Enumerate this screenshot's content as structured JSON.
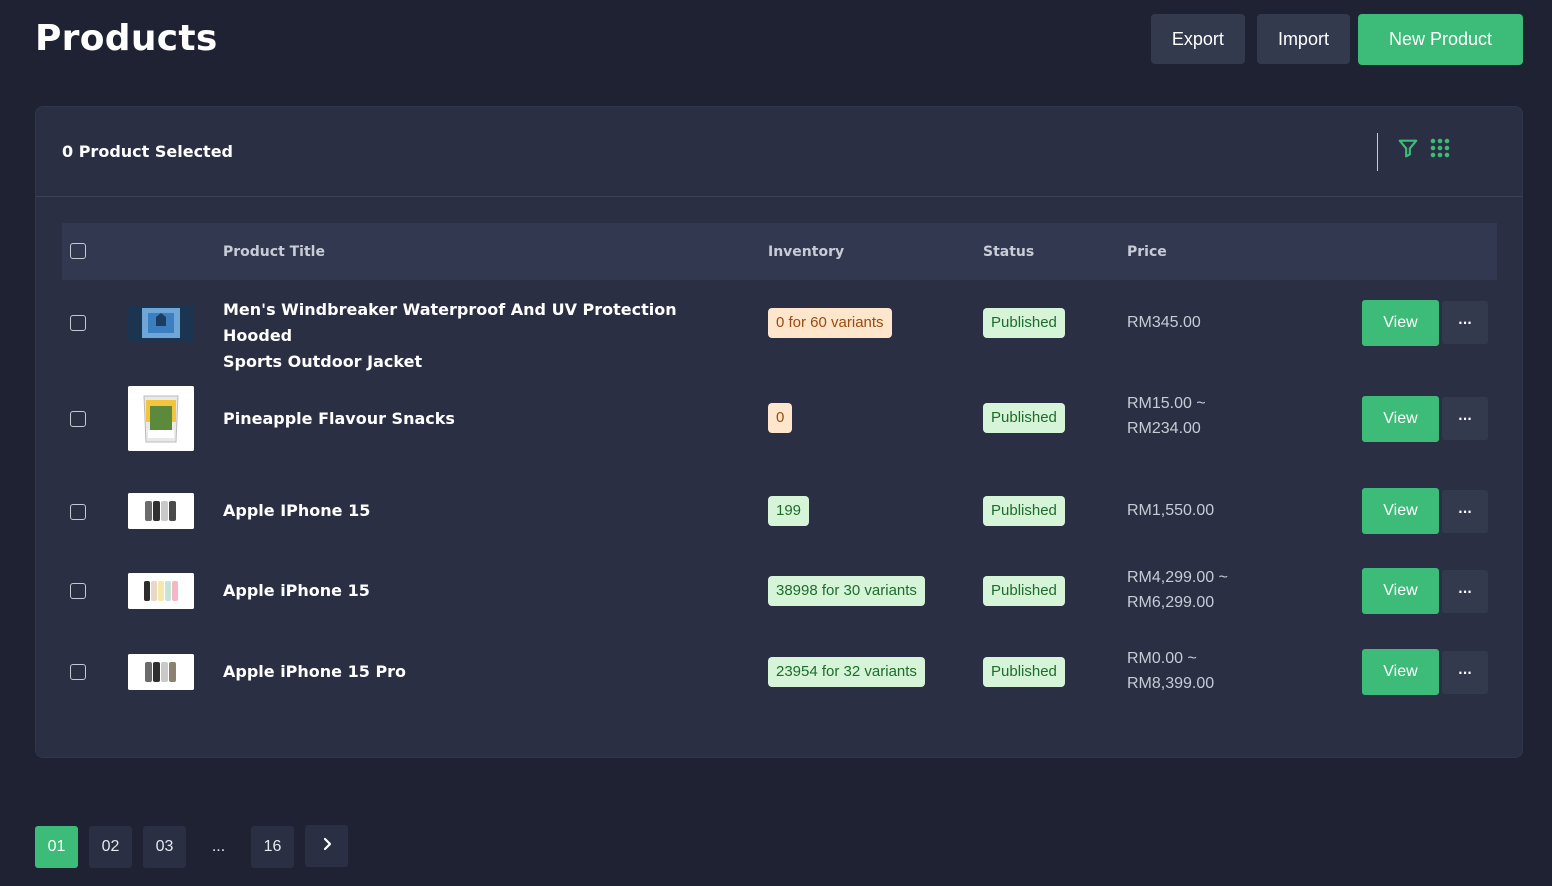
{
  "header": {
    "title": "Products",
    "export_label": "Export",
    "import_label": "Import",
    "new_label": "New Product"
  },
  "toolbar": {
    "selected_text": "0 Product Selected"
  },
  "table": {
    "columns": {
      "title": "Product Title",
      "inventory": "Inventory",
      "status": "Status",
      "price": "Price"
    },
    "rows": [
      {
        "title_line1": "Men's Windbreaker Waterproof And UV Protection Hooded",
        "title_line2": "Sports Outdoor Jacket",
        "inventory": "0 for 60 variants",
        "status": "Published",
        "price_line1": "RM345.00",
        "price_line2": "",
        "view_label": "View",
        "more_label": "···"
      },
      {
        "title_line1": "Pineapple Flavour Snacks",
        "title_line2": "",
        "inventory": "0",
        "status": "Published",
        "price_line1": "RM15.00 ~",
        "price_line2": "RM234.00",
        "view_label": "View",
        "more_label": "···"
      },
      {
        "title_line1": "Apple IPhone 15",
        "title_line2": "",
        "inventory": "199",
        "status": "Published",
        "price_line1": "RM1,550.00",
        "price_line2": "",
        "view_label": "View",
        "more_label": "···"
      },
      {
        "title_line1": "Apple iPhone 15",
        "title_line2": "",
        "inventory": "38998 for 30 variants",
        "status": "Published",
        "price_line1": "RM4,299.00 ~",
        "price_line2": "RM6,299.00",
        "view_label": "View",
        "more_label": "···"
      },
      {
        "title_line1": "Apple iPhone 15 Pro",
        "title_line2": "",
        "inventory": "23954 for 32 variants",
        "status": "Published",
        "price_line1": "RM0.00 ~",
        "price_line2": "RM8,399.00",
        "view_label": "View",
        "more_label": "···"
      }
    ]
  },
  "pagination": {
    "pages": [
      "01",
      "02",
      "03",
      "...",
      "16"
    ],
    "active": "01"
  },
  "colors": {
    "accent": "#3dbb78",
    "background": "#1e2233",
    "card": "#2a2f43"
  },
  "icons": {
    "filter": "filter-icon",
    "grid": "grid-icon",
    "next": "chevron-right-icon"
  }
}
